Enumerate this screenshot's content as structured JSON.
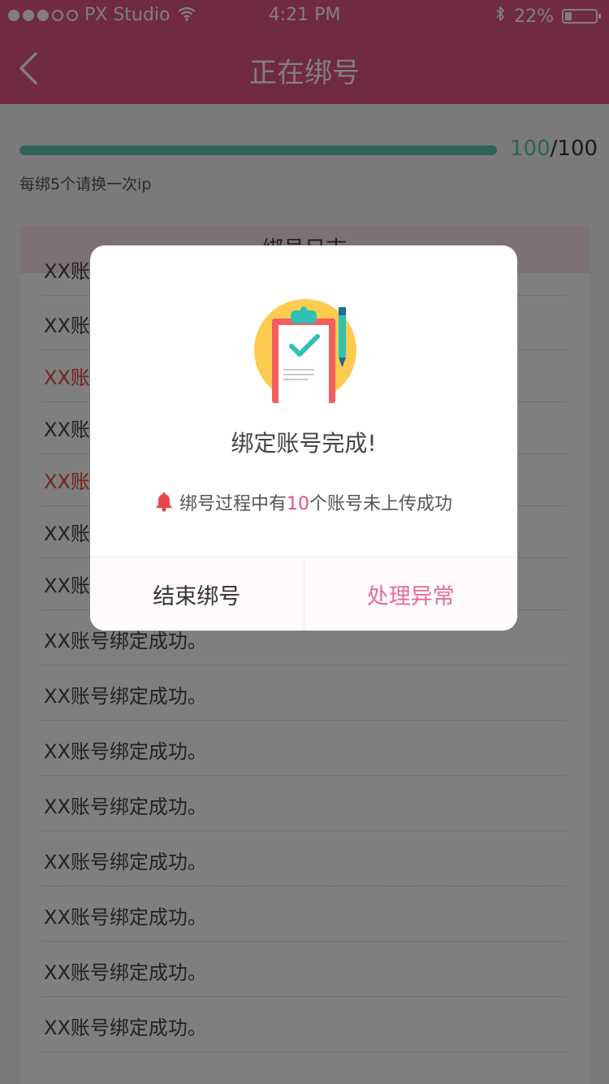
{
  "status_bar": {
    "carrier": "PX Studio",
    "time": "4:21 PM",
    "battery": "22%",
    "battery_level": 0.22,
    "signal_dots_filled": 3,
    "signal_dots_total": 5
  },
  "nav": {
    "title": "正在绑号"
  },
  "progress": {
    "current": "100",
    "separator": "/",
    "total": "100",
    "fraction": 1.0
  },
  "hint": "每绑5个请换一次ip",
  "log": {
    "header": "绑号日志",
    "items": [
      {
        "text": "XX账号绑定成功。",
        "status": "ok"
      },
      {
        "text": "XX账号绑定成功。",
        "status": "ok"
      },
      {
        "text": "XX账号绑定失败。",
        "status": "error"
      },
      {
        "text": "XX账号绑定成功。",
        "status": "ok"
      },
      {
        "text": "XX账号绑定失败。",
        "status": "error"
      },
      {
        "text": "XX账号绑定成功。",
        "status": "ok"
      },
      {
        "text": "XX账号绑定成功。",
        "status": "ok"
      },
      {
        "text": "XX账号绑定成功。",
        "status": "ok"
      },
      {
        "text": "XX账号绑定成功。",
        "status": "ok"
      },
      {
        "text": "XX账号绑定成功。",
        "status": "ok"
      },
      {
        "text": "XX账号绑定成功。",
        "status": "ok"
      },
      {
        "text": "XX账号绑定成功。",
        "status": "ok"
      },
      {
        "text": "XX账号绑定成功。",
        "status": "ok"
      },
      {
        "text": "XX账号绑定成功。",
        "status": "ok"
      },
      {
        "text": "XX账号绑定成功。",
        "status": "ok"
      }
    ]
  },
  "dialog": {
    "title": "绑定账号完成!",
    "message_prefix": "绑号过程中有",
    "message_count": "10",
    "message_suffix": "个账号未上传成功",
    "cancel_label": "结束绑号",
    "confirm_label": "处理异常"
  },
  "colors": {
    "brand": "#e05582",
    "progress": "#5ec7b0",
    "error": "#e8464b",
    "confirm": "#e86c9a"
  },
  "icons": [
    "back-chevron-icon",
    "wifi-icon",
    "bluetooth-icon",
    "battery-icon",
    "clipboard-check-icon",
    "bell-icon"
  ]
}
